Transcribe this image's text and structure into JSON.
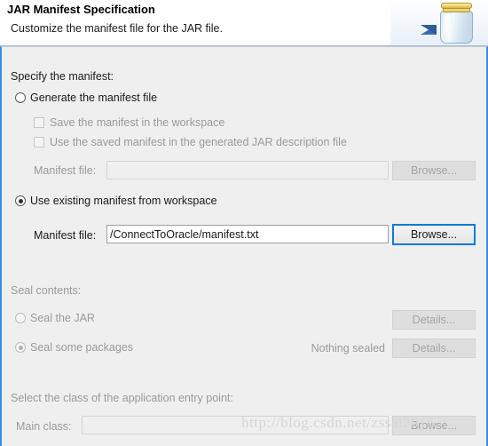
{
  "header": {
    "title": "JAR Manifest Specification",
    "subtitle": "Customize the manifest file for the JAR file.",
    "icon": "jar-icon",
    "arrow_icon": "blue-arrow-icon"
  },
  "manifest_section": {
    "label": "Specify the manifest:",
    "generate_radio": {
      "label": "Generate the manifest file",
      "checked": false,
      "enabled": true
    },
    "save_checkbox": {
      "label": "Save the manifest in the workspace",
      "checked": false,
      "enabled": false
    },
    "use_saved_checkbox": {
      "label": "Use the saved manifest in the generated JAR description file",
      "checked": false,
      "enabled": false
    },
    "generate_file_label": "Manifest file:",
    "generate_file_value": "",
    "generate_browse_label": "Browse...",
    "existing_radio": {
      "label": "Use existing manifest from workspace",
      "checked": true,
      "enabled": true
    },
    "existing_file_label": "Manifest file:",
    "existing_file_value": "/ConnectToOracle/manifest.txt",
    "existing_browse_label": "Browse..."
  },
  "seal_section": {
    "label": "Seal contents:",
    "seal_jar_radio": {
      "label": "Seal the JAR",
      "checked": false,
      "enabled": false
    },
    "seal_packages_radio": {
      "label": "Seal some packages",
      "checked": true,
      "enabled": false
    },
    "seal_jar_details_label": "Details...",
    "seal_packages_details_label": "Details...",
    "nothing_sealed_status": "Nothing sealed"
  },
  "entry_point_section": {
    "label": "Select the class of the application entry point:",
    "main_class_label": "Main class:",
    "main_class_value": "",
    "main_class_browse_label": "Browse..."
  },
  "watermark": {
    "text": "http://blog.csdn.net/zssai2015"
  },
  "colors": {
    "accent_blue": "#3c8ddc",
    "focus_blue": "#0b7ad6",
    "panel_bg": "#efefef",
    "disabled_text": "#9a9a9a"
  }
}
